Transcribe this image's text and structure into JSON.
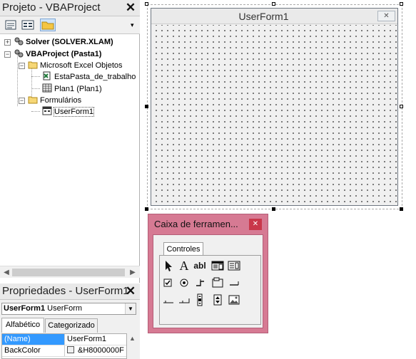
{
  "project_explorer": {
    "title": "Projeto - VBAProject",
    "close_glyph": "✕",
    "toolbar": [
      "view-code-icon",
      "view-object-icon",
      "toggle-folders-icon"
    ],
    "tree": [
      {
        "label": "Solver (SOLVER.XLAM)",
        "icon": "vbproject-icon",
        "bold": true
      },
      {
        "label": "VBAProject (Pasta1)",
        "icon": "vbproject-icon",
        "bold": true
      },
      {
        "label": "Microsoft Excel Objetos",
        "icon": "folder-open-icon"
      },
      {
        "label": "EstaPasta_de_trabalho",
        "icon": "workbook-icon"
      },
      {
        "label": "Plan1 (Plan1)",
        "icon": "worksheet-icon"
      },
      {
        "label": "Formulários",
        "icon": "folder-open-icon"
      },
      {
        "label": "UserForm1",
        "icon": "userform-icon",
        "selected": true
      }
    ]
  },
  "properties": {
    "title": "Propriedades - UserForm1",
    "object_name": "UserForm1",
    "object_type": "UserForm",
    "tabs": [
      "Alfabético",
      "Categorizado"
    ],
    "active_tab": "Alfabético",
    "rows": [
      {
        "name": "(Name)",
        "value": "UserForm1",
        "selected": true
      },
      {
        "name": "BackColor",
        "value": "&H8000000F",
        "swatch": "#f0f0f0"
      }
    ]
  },
  "userform": {
    "caption": "UserForm1",
    "close_glyph": "✕"
  },
  "toolbox": {
    "title": "Caixa de ferramen...",
    "close_glyph": "✕",
    "tab": "Controles",
    "tools": [
      "select-pointer-icon",
      "label-icon",
      "textbox-icon",
      "combobox-icon",
      "listbox-icon",
      "checkbox-icon",
      "optionbutton-icon",
      "togglebutton-icon",
      "frame-icon",
      "commandbutton-icon",
      "tabstrip-icon",
      "multipage-icon",
      "scrollbar-icon",
      "spinbutton-icon",
      "image-icon"
    ],
    "labels": {
      "label_glyph": "A",
      "textbox_glyph": "abl"
    }
  },
  "colors": {
    "toolbox_frame": "#d67a93",
    "toolbox_close": "#c9374a",
    "selection": "#3399ff"
  }
}
